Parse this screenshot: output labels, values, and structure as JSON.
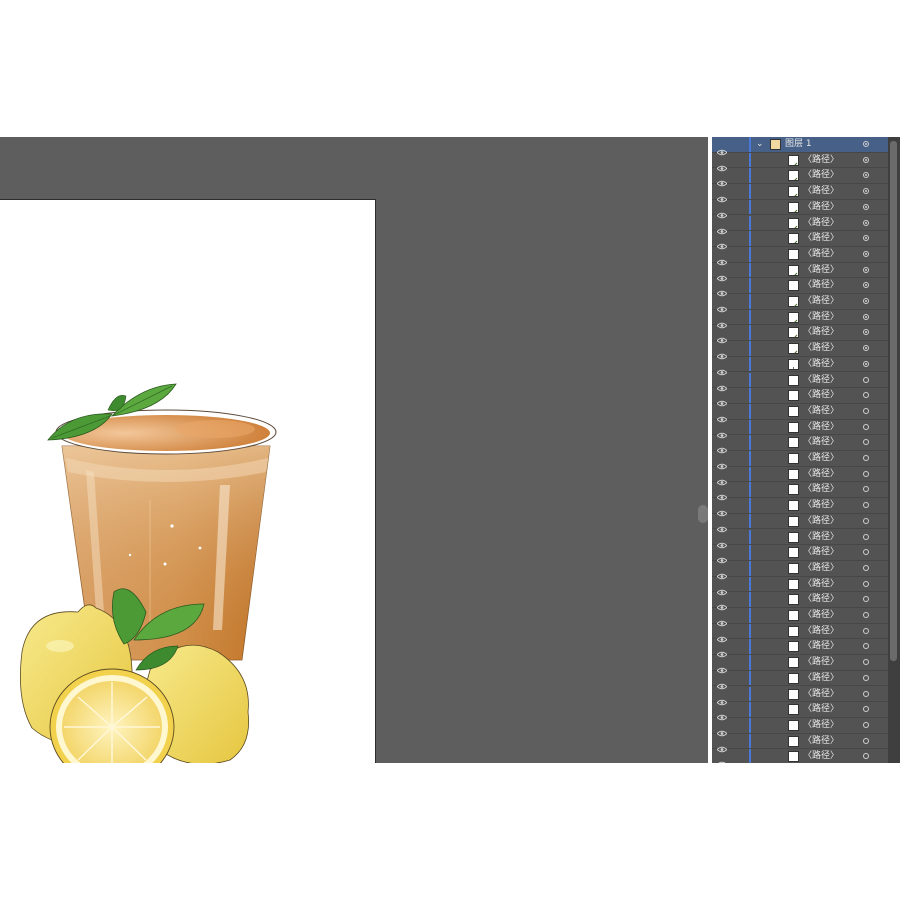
{
  "colors": {
    "workspace": "#5e5e5e",
    "panel": "#535353",
    "selected_row": "#466087",
    "layer_color_bar": "#4a78d8"
  },
  "layers_panel": {
    "top_layer": {
      "label": "图层 1",
      "expanded": true,
      "icons": [
        "eye-icon",
        "chevron-down-icon",
        "target-circle-icon"
      ]
    },
    "path_items": [
      {
        "label": "〈路径〉",
        "thumb": "diag-line"
      },
      {
        "label": "〈路径〉",
        "thumb": "diag-line"
      },
      {
        "label": "〈路径〉",
        "thumb": "diag-line"
      },
      {
        "label": "〈路径〉",
        "thumb": "diag-line"
      },
      {
        "label": "〈路径〉",
        "thumb": "diag-line"
      },
      {
        "label": "〈路径〉",
        "thumb": "diag-line"
      },
      {
        "label": "〈路径〉",
        "thumb": "h-line"
      },
      {
        "label": "〈路径〉",
        "thumb": "diag-line"
      },
      {
        "label": "〈路径〉",
        "thumb": "h-line"
      },
      {
        "label": "〈路径〉",
        "thumb": "diag-line"
      },
      {
        "label": "〈路径〉",
        "thumb": "diag-line"
      },
      {
        "label": "〈路径〉",
        "thumb": "diag-line"
      },
      {
        "label": "〈路径〉",
        "thumb": "diag-line"
      },
      {
        "label": "〈路径〉",
        "thumb": "v-line"
      },
      {
        "label": "〈路径〉",
        "thumb": "blank"
      },
      {
        "label": "〈路径〉",
        "thumb": "blank"
      },
      {
        "label": "〈路径〉",
        "thumb": "blank"
      },
      {
        "label": "〈路径〉",
        "thumb": "blank"
      },
      {
        "label": "〈路径〉",
        "thumb": "blank"
      },
      {
        "label": "〈路径〉",
        "thumb": "blank"
      },
      {
        "label": "〈路径〉",
        "thumb": "blank"
      },
      {
        "label": "〈路径〉",
        "thumb": "blank"
      },
      {
        "label": "〈路径〉",
        "thumb": "blank"
      },
      {
        "label": "〈路径〉",
        "thumb": "blank"
      },
      {
        "label": "〈路径〉",
        "thumb": "blank"
      },
      {
        "label": "〈路径〉",
        "thumb": "blank"
      },
      {
        "label": "〈路径〉",
        "thumb": "blank"
      },
      {
        "label": "〈路径〉",
        "thumb": "blank"
      },
      {
        "label": "〈路径〉",
        "thumb": "blank"
      },
      {
        "label": "〈路径〉",
        "thumb": "blank"
      },
      {
        "label": "〈路径〉",
        "thumb": "blank"
      },
      {
        "label": "〈路径〉",
        "thumb": "blank"
      },
      {
        "label": "〈路径〉",
        "thumb": "blank"
      },
      {
        "label": "〈路径〉",
        "thumb": "blank"
      },
      {
        "label": "〈路径〉",
        "thumb": "blank"
      },
      {
        "label": "〈路径〉",
        "thumb": "blank"
      },
      {
        "label": "〈路径〉",
        "thumb": "blank"
      },
      {
        "label": "〈路径〉",
        "thumb": "blank"
      },
      {
        "label": "〈路径〉",
        "thumb": "blank"
      }
    ]
  },
  "artboard": {
    "artwork_name": "lemon-tea-illustration",
    "colors": {
      "tea_light": "#e9bd8c",
      "tea_dark": "#c77a2c",
      "lemon": "#f0dc6a",
      "leaf": "#5aa23a"
    }
  }
}
